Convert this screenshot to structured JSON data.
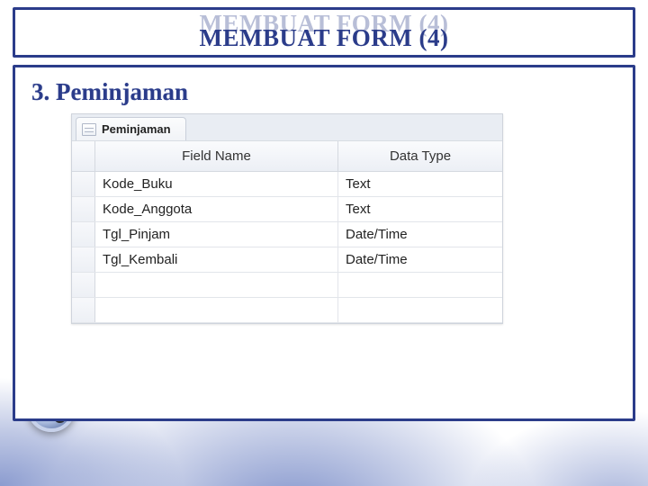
{
  "title": "MEMBUAT FORM (4)",
  "section_heading": "3. Peminjaman",
  "table": {
    "tab_label": "Peminjaman",
    "headers": {
      "field_name": "Field Name",
      "data_type": "Data Type"
    },
    "rows": [
      {
        "field": "Kode_Buku",
        "type": "Text"
      },
      {
        "field": "Kode_Anggota",
        "type": "Text"
      },
      {
        "field": "Tgl_Pinjam",
        "type": "Date/Time"
      },
      {
        "field": "Tgl_Kembali",
        "type": "Date/Time"
      }
    ]
  }
}
